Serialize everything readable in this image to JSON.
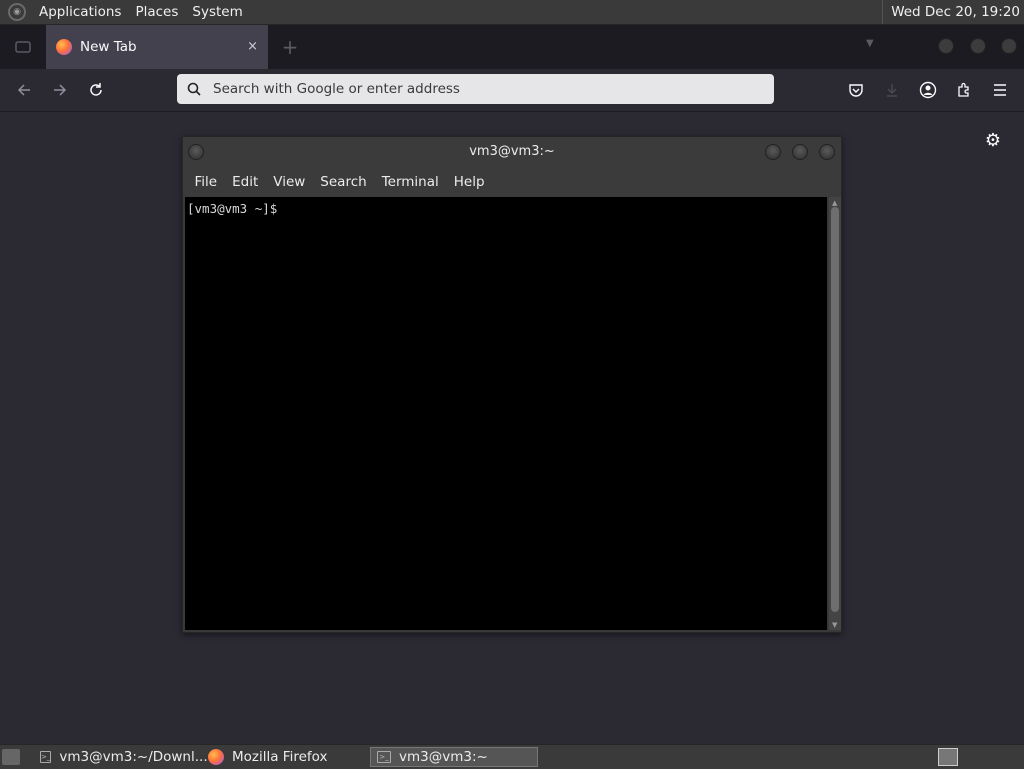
{
  "top_panel": {
    "menus": [
      "Applications",
      "Places",
      "System"
    ],
    "clock": "Wed Dec 20, 19:20"
  },
  "browser": {
    "tab": {
      "label": "New Tab",
      "close": "×"
    },
    "new_tab": "+",
    "url_bar": {
      "placeholder": "Search with Google or enter address"
    }
  },
  "terminal": {
    "title": "vm3@vm3:~",
    "menu": [
      "File",
      "Edit",
      "View",
      "Search",
      "Terminal",
      "Help"
    ],
    "prompt": "[vm3@vm3 ~]$"
  },
  "taskbar": {
    "tasks": [
      {
        "label": "vm3@vm3:~/Downl..."
      },
      {
        "label": "Mozilla Firefox"
      },
      {
        "label": "vm3@vm3:~"
      }
    ]
  },
  "colors": {
    "browser_bg": "#2b2a33",
    "tab_active": "#42414d",
    "url_bar": "#e6e6e9",
    "terminal_bg": "#000000"
  }
}
